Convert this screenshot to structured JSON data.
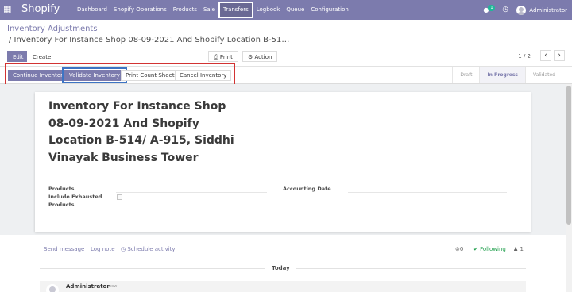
{
  "navbar": {
    "apps_icon": "grid-icon",
    "brand": "Shopify",
    "menu": [
      "Dashboard",
      "Shopify Operations",
      "Products",
      "Sale",
      "Transfers",
      "Logbook",
      "Queue",
      "Configuration"
    ],
    "active_menu": "Transfers",
    "chat_count": "1",
    "user": "Administrator",
    "accent": "#7c7bad"
  },
  "breadcrumb": {
    "parent": "Inventory Adjustments",
    "current": "/ Inventory For Instance Shop 08-09-2021 And Shopify Location B-51…"
  },
  "toolbar": {
    "edit": "Edit",
    "create": "Create",
    "print": "Print",
    "action": "Action",
    "pager": "1 / 2"
  },
  "statusbar": {
    "buttons": [
      "Continue Inventory",
      "Validate Inventory",
      "Print Count Sheet",
      "Cancel Inventory"
    ],
    "stages": [
      "Draft",
      "In Progress",
      "Validated"
    ],
    "active_stage": "In Progress"
  },
  "form": {
    "title": "Inventory For Instance Shop 08-09-2021 And Shopify Location B-514/ A-915, Siddhi Vinayak Business Tower",
    "products_label": "Products",
    "include_exhausted_label": "Include Exhausted Products",
    "include_exhausted_value": false,
    "accounting_date_label": "Accounting Date"
  },
  "chatter": {
    "send_message": "Send message",
    "log_note": "Log note",
    "schedule_activity": "Schedule activity",
    "attachments": "0",
    "following": "Following",
    "followers": "1",
    "today": "Today",
    "author": "Administrator",
    "time": "now"
  }
}
